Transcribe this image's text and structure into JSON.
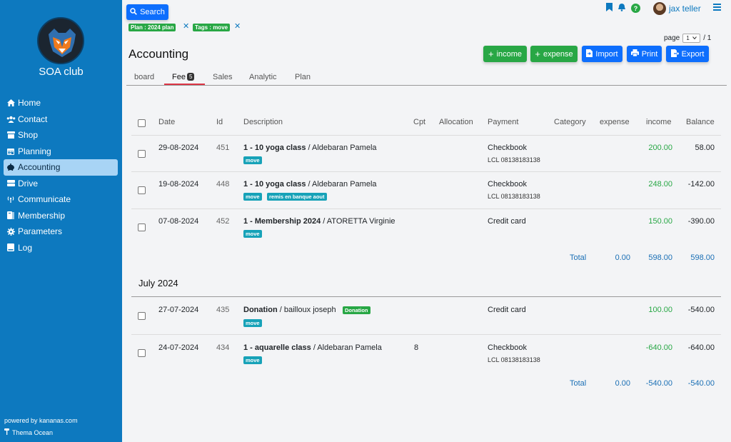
{
  "sidebar": {
    "brand": "SOA club",
    "nav": [
      {
        "label": "Home",
        "icon": "home-icon",
        "active": false
      },
      {
        "label": "Contact",
        "icon": "users-icon",
        "active": false
      },
      {
        "label": "Shop",
        "icon": "store-icon",
        "active": false
      },
      {
        "label": "Planning",
        "icon": "calendar-icon",
        "active": false
      },
      {
        "label": "Accounting",
        "icon": "piggy-bank-icon",
        "active": true
      },
      {
        "label": "Drive",
        "icon": "drive-icon",
        "active": false
      },
      {
        "label": "Communicate",
        "icon": "broadcast-icon",
        "active": false
      },
      {
        "label": "Membership",
        "icon": "id-card-icon",
        "active": false
      },
      {
        "label": "Parameters",
        "icon": "gear-icon",
        "active": false
      },
      {
        "label": "Log",
        "icon": "book-icon",
        "active": false
      }
    ],
    "powered_by": "powered by kananas.com",
    "theme": "Thema Ocean"
  },
  "topbar": {
    "search_label": "Search",
    "filters": [
      {
        "label": "Plan : 2024 plan"
      },
      {
        "label": "Tags : move"
      }
    ],
    "user_name": "jax teller",
    "help_glyph": "?"
  },
  "pager": {
    "label": "page",
    "current": "1",
    "total": "/ 1"
  },
  "page_title": "Accounting",
  "actions": {
    "income": "income",
    "expense": "expense",
    "import": "Import",
    "print": "Print",
    "export": "Export"
  },
  "tabs": [
    {
      "label": "board"
    },
    {
      "label": "Fee",
      "badge": "5",
      "active": true
    },
    {
      "label": "Sales"
    },
    {
      "label": "Analytic"
    },
    {
      "label": "Plan"
    }
  ],
  "table": {
    "headers": {
      "date": "Date",
      "id": "Id",
      "description": "Description",
      "cpt": "Cpt",
      "allocation": "Allocation",
      "payment": "Payment",
      "category": "Category",
      "expense": "expense",
      "income": "income",
      "balance": "Balance"
    },
    "rows": [
      {
        "date": "29-08-2024",
        "id": "451",
        "title": "1 - 10 yoga class",
        "who": " / Aldebaran Pamela",
        "cpt": "",
        "payment": "Checkbook",
        "payment_detail": "LCL 08138183138",
        "income": "200.00",
        "balance": "58.00",
        "tags": [
          "move"
        ]
      },
      {
        "date": "19-08-2024",
        "id": "448",
        "title": "1 - 10 yoga class",
        "who": " / Aldebaran Pamela",
        "cpt": "",
        "payment": "Checkbook",
        "payment_detail": "LCL 08138183138",
        "income": "248.00",
        "balance": "-142.00",
        "tags": [
          "move",
          "remis en banque aout"
        ]
      },
      {
        "date": "07-08-2024",
        "id": "452",
        "title": "1 - Membership 2024",
        "who": " / ATORETTA Virginie",
        "cpt": "",
        "payment": "Credit card",
        "payment_detail": "",
        "income": "150.00",
        "balance": "-390.00",
        "tags": [
          "move"
        ]
      }
    ],
    "total1": {
      "label": "Total",
      "expense": "0.00",
      "income": "598.00",
      "balance": "598.00"
    },
    "month": "July 2024",
    "rows2": [
      {
        "date": "27-07-2024",
        "id": "435",
        "title": "Donation",
        "who": " / bailloux joseph",
        "inline_tag": "Donation",
        "cpt": "",
        "payment": "Credit card",
        "payment_detail": "",
        "income": "100.00",
        "balance": "-540.00",
        "tags": [
          "move"
        ]
      },
      {
        "date": "24-07-2024",
        "id": "434",
        "title": "1 - aquarelle class",
        "who": " / Aldebaran Pamela",
        "cpt": "8",
        "payment": "Checkbook",
        "payment_detail": "LCL 08138183138",
        "income": "-640.00",
        "balance": "-640.00",
        "tags": [
          "move"
        ]
      }
    ],
    "total2": {
      "label": "Total",
      "expense": "0.00",
      "income": "-540.00",
      "balance": "-540.00"
    }
  }
}
